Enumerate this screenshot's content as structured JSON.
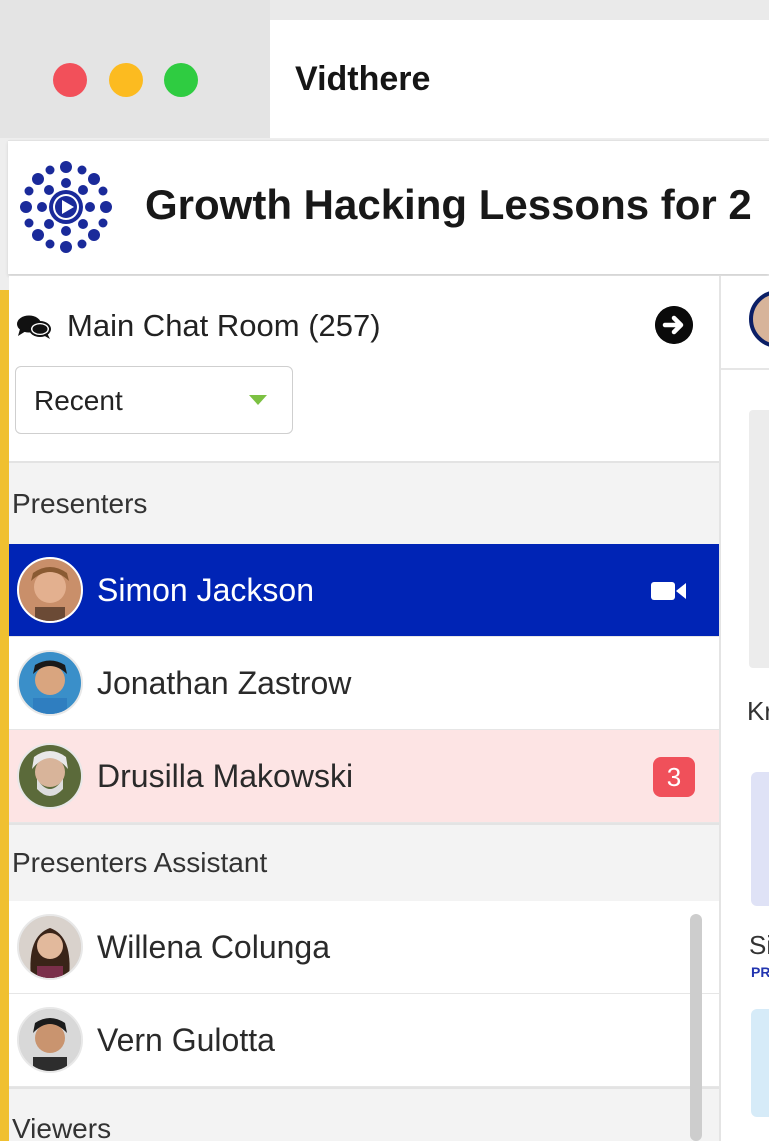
{
  "window": {
    "app_title": "Vidthere"
  },
  "header": {
    "logo_icon": "vidthere-logo-icon",
    "webinar_title": "Growth Hacking Lessons for 2"
  },
  "sidebar": {
    "chat_room_label": "Main Chat Room (257)",
    "sort": {
      "selected": "Recent"
    },
    "sections": [
      {
        "title": "Presenters",
        "people": [
          {
            "name": "Simon Jackson",
            "state": "active",
            "video": true
          },
          {
            "name": "Jonathan Zastrow"
          },
          {
            "name": "Drusilla Makowski",
            "state": "unread",
            "badge": "3"
          }
        ]
      },
      {
        "title": "Presenters Assistant",
        "people": [
          {
            "name": "Willena Colunga"
          },
          {
            "name": "Vern Gulotta"
          }
        ]
      },
      {
        "title": "Viewers",
        "people": []
      }
    ]
  },
  "main": {
    "fragment_1": "Kr",
    "fragment_2": "Si",
    "fragment_3": "PR"
  },
  "colors": {
    "active_row": "#0024b5",
    "unread_row": "#fde4e4",
    "badge": "#f0505a",
    "accent_bar": "#f0c030",
    "dropdown_caret": "#7cc142"
  }
}
